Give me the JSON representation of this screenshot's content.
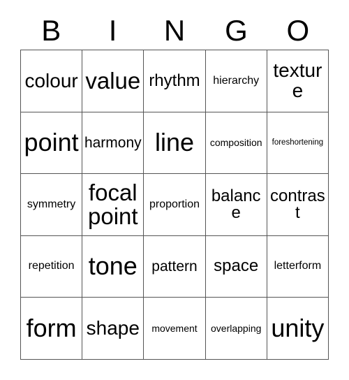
{
  "title": "BINGO Card",
  "header": {
    "letters": [
      "B",
      "I",
      "N",
      "G",
      "O"
    ]
  },
  "colors": {
    "grid_line": "#555555",
    "text": "#000000",
    "cell_background": "#ffffff",
    "page_background": "#ffffff"
  },
  "grid": {
    "columns": 5,
    "rows": 5,
    "cells": [
      [
        {
          "label": "colour",
          "size": "lg"
        },
        {
          "label": "value",
          "size": "xl"
        },
        {
          "label": "rhythm",
          "size": "md"
        },
        {
          "label": "hierarchy",
          "size": "xs"
        },
        {
          "label": "texture",
          "size": "lg"
        }
      ],
      [
        {
          "label": "point",
          "size": "xxl"
        },
        {
          "label": "harmony",
          "size": "sm"
        },
        {
          "label": "line",
          "size": "xxl"
        },
        {
          "label": "composition",
          "size": "xxs"
        },
        {
          "label": "foreshortening",
          "size": "tiny"
        }
      ],
      [
        {
          "label": "symmetry",
          "size": "xs"
        },
        {
          "label": "focal point",
          "size": "xl"
        },
        {
          "label": "proportion",
          "size": "xs"
        },
        {
          "label": "balance",
          "size": "md"
        },
        {
          "label": "contrast",
          "size": "md"
        }
      ],
      [
        {
          "label": "repetition",
          "size": "xs"
        },
        {
          "label": "tone",
          "size": "xxl"
        },
        {
          "label": "pattern",
          "size": "sm"
        },
        {
          "label": "space",
          "size": "md"
        },
        {
          "label": "letterform",
          "size": "xs"
        }
      ],
      [
        {
          "label": "form",
          "size": "xxl"
        },
        {
          "label": "shape",
          "size": "lg"
        },
        {
          "label": "movement",
          "size": "xxs"
        },
        {
          "label": "overlapping",
          "size": "xxs"
        },
        {
          "label": "unity",
          "size": "xxl"
        }
      ]
    ]
  }
}
